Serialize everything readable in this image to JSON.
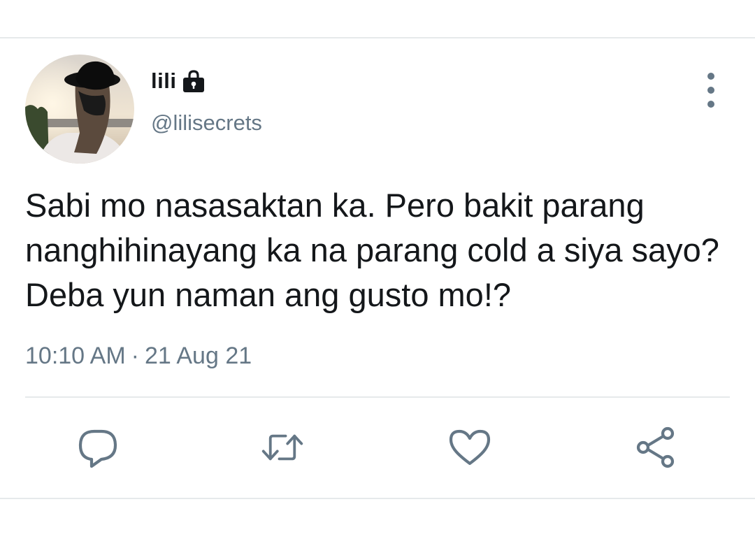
{
  "tweet": {
    "display_name": "lili",
    "handle": "@lilisecrets",
    "text": "Sabi mo nasasaktan ka. Pero bakit parang nanghihinayang ka na parang cold a siya sayo? Deba yun naman ang gusto mo!?",
    "time": "10:10 AM",
    "separator": "·",
    "date": "21 Aug 21"
  },
  "icons": {
    "lock": "lock-icon",
    "more": "more-vertical-icon",
    "reply": "reply-icon",
    "retweet": "retweet-icon",
    "like": "heart-icon",
    "share": "share-icon"
  },
  "colors": {
    "text_primary": "#14171a",
    "text_secondary": "#657786",
    "divider": "#e6e9eb"
  }
}
